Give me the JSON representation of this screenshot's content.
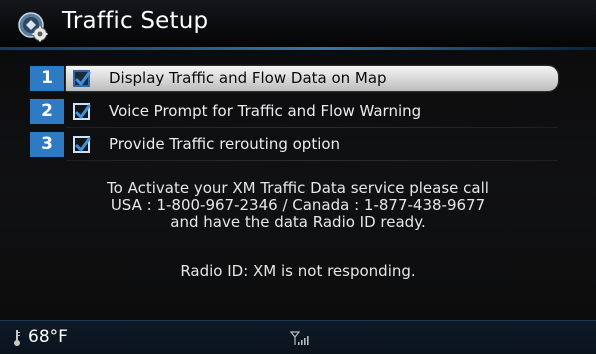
{
  "header": {
    "title": "Traffic Setup",
    "icon": "navigation-settings-icon"
  },
  "options": [
    {
      "number": "1",
      "label": "Display Traffic and Flow Data on Map",
      "checked": true,
      "selected": true
    },
    {
      "number": "2",
      "label": "Voice Prompt for Traffic and Flow Warning",
      "checked": true,
      "selected": false
    },
    {
      "number": "3",
      "label": "Provide Traffic rerouting option",
      "checked": true,
      "selected": false
    }
  ],
  "info": {
    "line1": "To Activate your XM Traffic Data service please call",
    "line2": "USA : 1-800-967-2346 / Canada : 1-877-438-9677",
    "line3": "and have the data Radio ID ready."
  },
  "radio_id": "Radio ID: XM is not responding.",
  "status": {
    "temperature": "68°F",
    "icons": [
      "thermometer-icon",
      "signal-strength-icon"
    ]
  },
  "colors": {
    "accent_blue": "#2e7bc4",
    "selected_row": "#dcdcdc",
    "background": "#0c0c0d",
    "status_bar": "#0e1a26"
  }
}
